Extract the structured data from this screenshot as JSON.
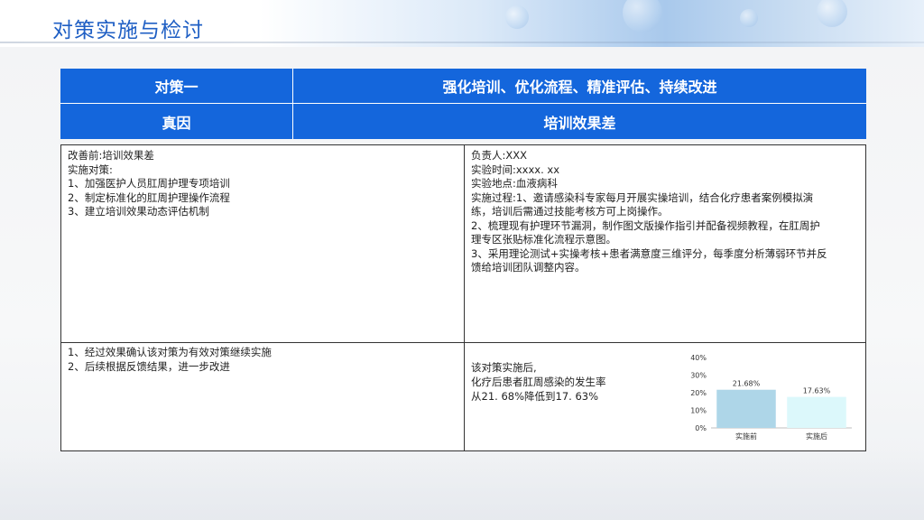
{
  "page": {
    "title": "对策实施与检讨"
  },
  "header_table": {
    "row1": {
      "label": "对策一",
      "value": "强化培训、优化流程、精准评估、持续改进"
    },
    "row2": {
      "label": "真因",
      "value": "培训效果差"
    }
  },
  "before_section": {
    "lines": [
      "改善前:培训效果差",
      "实施对策:",
      "1、加强医护人员肛周护理专项培训",
      "2、制定标准化的肛周护理操作流程",
      "3、建立培训效果动态评估机制"
    ]
  },
  "experiment_section": {
    "owner": "负责人:XXX",
    "time": "实验时间:xxxx. xx",
    "location": "实验地点:血液病科",
    "process_lines": [
      "实施过程:1、邀请感染科专家每月开展实操培训，结合化疗患者案例模拟演",
      "练，培训后需通过技能考核方可上岗操作。",
      "2、梳理现有护理环节漏洞，制作图文版操作指引并配备视频教程，在肛周护",
      "理专区张贴标准化流程示意图。",
      "3、采用理论测试+实操考核+患者满意度三维评分，每季度分析薄弱环节并反",
      "馈给培训团队调整内容。"
    ]
  },
  "conclusion_section": {
    "lines": [
      "1、经过效果确认该对策为有效对策继续实施",
      "2、后续根据反馈结果，进一步改进"
    ]
  },
  "result_section": {
    "lines": [
      "该对策实施后,",
      "化疗后患者肛周感染的发生率",
      "从21. 68%降低到17. 63%"
    ]
  },
  "chart_data": {
    "type": "bar",
    "categories": [
      "实施前",
      "实施后"
    ],
    "values": [
      21.68,
      17.63
    ],
    "data_labels": [
      "21.68%",
      "17.63%"
    ],
    "ylim": [
      0,
      40
    ],
    "yticks": [
      0,
      10,
      20,
      30,
      40
    ],
    "ytick_labels": [
      "0%",
      "10%",
      "20%",
      "30%",
      "40%"
    ],
    "bar_colors": [
      "#aed6e8",
      "#dcf8fb"
    ],
    "grid": false,
    "title": "",
    "xlabel": "",
    "ylabel": ""
  }
}
